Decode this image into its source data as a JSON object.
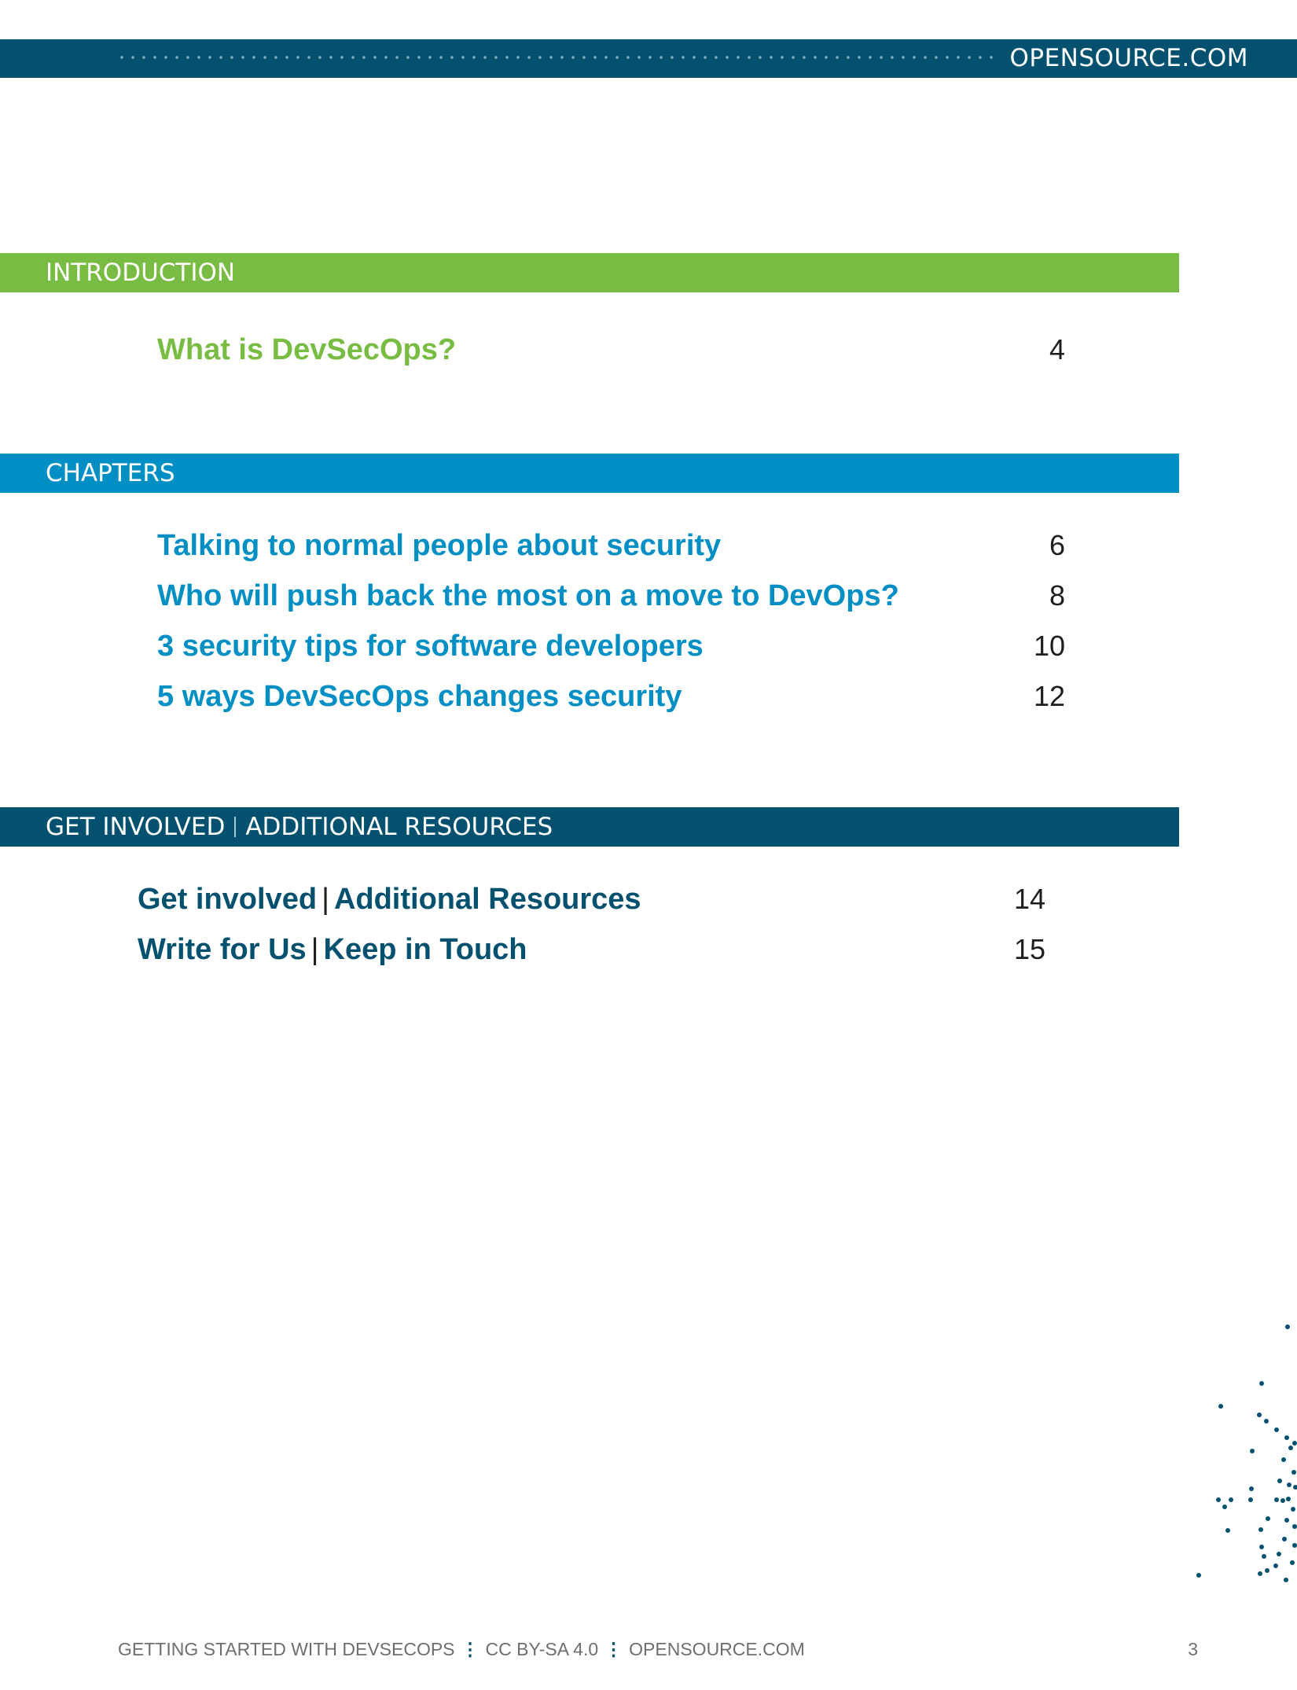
{
  "header": {
    "site": "OPENSOURCE.COM"
  },
  "sections": {
    "introduction": {
      "title": "INTRODUCTION",
      "entries": [
        {
          "title": "What is DevSecOps?",
          "page": "4"
        }
      ]
    },
    "chapters": {
      "title": "CHAPTERS",
      "entries": [
        {
          "title": "Talking to normal people about security",
          "page": "6"
        },
        {
          "title": "Who will push back the most on a move to DevOps?",
          "page": "8"
        },
        {
          "title": "3 security tips for software developers",
          "page": "10"
        },
        {
          "title": "5 ways DevSecOps changes security",
          "page": "12"
        }
      ]
    },
    "involved": {
      "title_left": "GET INVOLVED",
      "title_right": "ADDITIONAL RESOURCES",
      "entries": [
        {
          "left": "Get involved",
          "right": "Additional Resources",
          "page": "14"
        },
        {
          "left": "Write for Us",
          "right": "Keep in Touch",
          "page": "15"
        }
      ]
    }
  },
  "footer": {
    "book_title": "GETTING STARTED WITH DEVSECOPS",
    "separator": "⋮",
    "license": "CC BY-SA 4.0",
    "site": "OPENSOURCE.COM",
    "page_number": "3"
  },
  "colors": {
    "dark_teal": "#03516f",
    "green": "#79bc43",
    "blue": "#008fc4",
    "text": "#1e1e1e",
    "footer_text": "#6e6e6e"
  }
}
